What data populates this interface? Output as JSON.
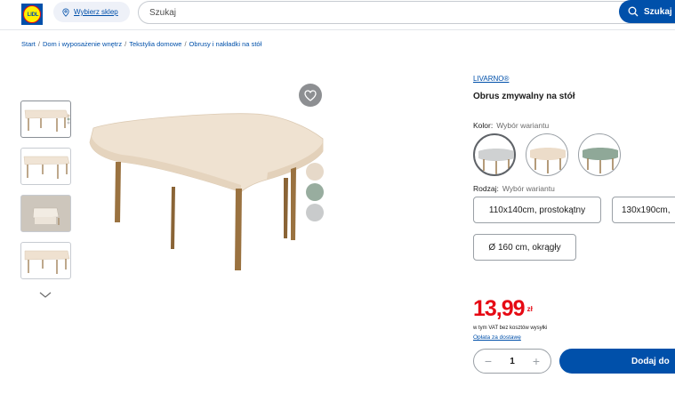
{
  "header": {
    "logo_text": "LIDL",
    "store_label": "Wybierz sklep",
    "search_placeholder": "Szukaj",
    "search_button": "Szukaj"
  },
  "breadcrumb": [
    "Start",
    "Dom i wyposażenie wnętrz",
    "Tekstylia domowe",
    "Obrusy i nakładki na stół"
  ],
  "product": {
    "brand": "LIVARNO®",
    "title": "Obrus zmywalny na stół",
    "color_label": "Kolor:",
    "color_hint": "Wybór wariantu",
    "colors": [
      {
        "name": "grey",
        "hex": "#cfd1d2"
      },
      {
        "name": "beige",
        "hex": "#ecdcc9"
      },
      {
        "name": "green",
        "hex": "#8fa898"
      }
    ],
    "size_label": "Rodzaj:",
    "size_hint": "Wybór wariantu",
    "sizes": [
      "110x140cm, prostokątny",
      "130x190cm,",
      "Ø 160 cm, okrągły"
    ],
    "price": "13,99",
    "currency": "zł",
    "vat_note": "w tym VAT bez kosztów wysyłki",
    "shipping_link": "Opłata za dostawę",
    "quantity": "1",
    "add_to_cart": "Dodaj do"
  },
  "gallery": {
    "side_dots": [
      {
        "hex": "#e6d9c9"
      },
      {
        "hex": "#98ad9f"
      },
      {
        "hex": "#c9cbcc"
      }
    ]
  }
}
